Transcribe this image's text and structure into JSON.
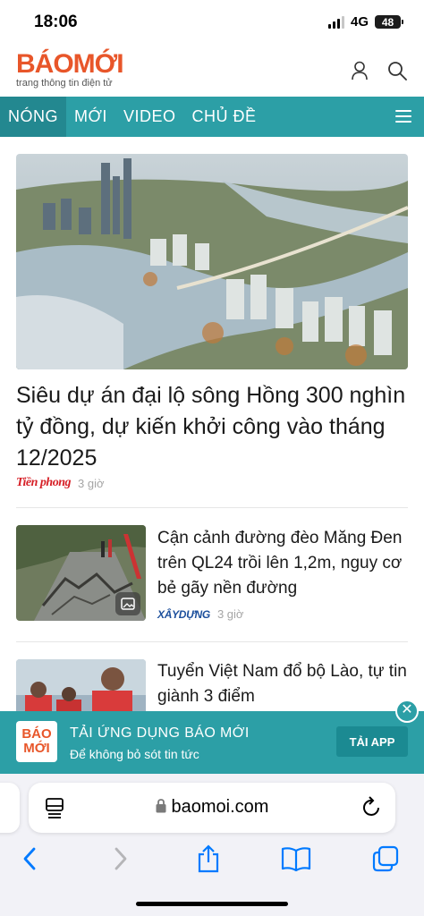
{
  "status": {
    "time": "18:06",
    "network": "4G",
    "battery": "48"
  },
  "header": {
    "logo_text": "BÁOMỚI",
    "tagline": "trang thông tin điện tử"
  },
  "nav": {
    "items": [
      "NÓNG",
      "MỚI",
      "VIDEO",
      "CHỦ ĐỀ"
    ],
    "active_index": 0
  },
  "featured": {
    "title": "Siêu dự án đại lộ sông Hồng 300 nghìn tỷ đồng, dự kiến khởi công vào tháng 12/2025",
    "source": "Tiền phong",
    "time": "3 giờ"
  },
  "articles": [
    {
      "title": "Cận cảnh đường đèo Măng Đen trên QL24 trồi lên 1,2m, nguy cơ bẻ gãy nền đường",
      "source": "XÂYDỰNG",
      "time": "3 giờ"
    },
    {
      "title": "Tuyển Việt Nam đổ bộ Lào, tự tin giành 3 điểm"
    }
  ],
  "app_banner": {
    "logo_line1": "BÁO",
    "logo_line2": "MỚI",
    "title": "TẢI ỨNG DỤNG BÁO MỚI",
    "subtitle": "Để không bỏ sót tin tức",
    "button": "TẢI APP"
  },
  "browser": {
    "url": "baomoi.com"
  },
  "colors": {
    "brand_teal": "#2c9fa6",
    "logo_orange": "#e8562a",
    "ios_blue": "#007aff"
  }
}
